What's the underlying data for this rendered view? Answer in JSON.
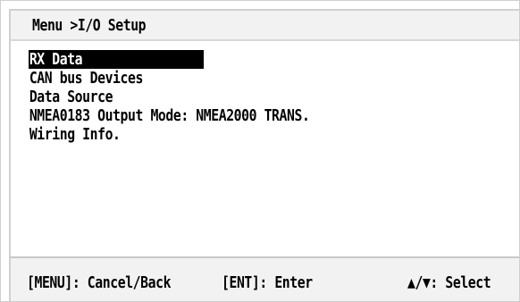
{
  "window": {
    "breadcrumb": "Menu >I/O Setup"
  },
  "menu": {
    "items": [
      {
        "label": "RX Data",
        "selected": true
      },
      {
        "label": "CAN bus Devices",
        "selected": false
      },
      {
        "label": "Data Source",
        "selected": false
      },
      {
        "label": "NMEA0183 Output Mode: NMEA2000 TRANS.",
        "selected": false
      },
      {
        "label": "Wiring Info.",
        "selected": false
      }
    ]
  },
  "footer": {
    "menu_hint": "[MENU]: Cancel/Back",
    "ent_hint": "[ENT]: Enter",
    "select_hint": "▲/▼: Select"
  },
  "colors": {
    "background": "#ffffff",
    "bar_background": "#f2f2f2",
    "highlight_bg": "#000000",
    "highlight_fg": "#ffffff",
    "text": "#000000"
  }
}
